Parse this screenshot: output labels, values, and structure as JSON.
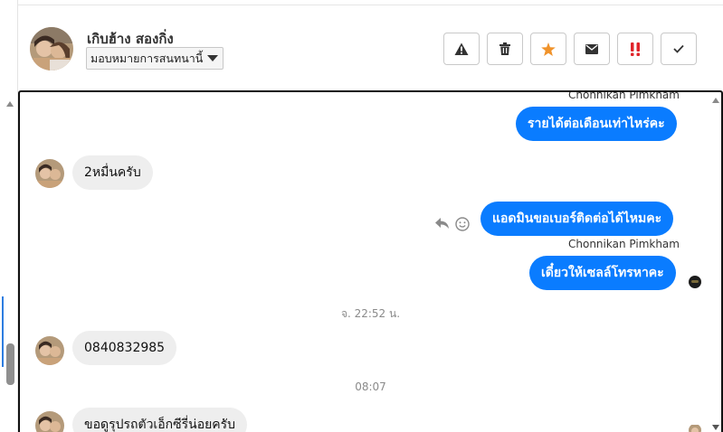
{
  "header": {
    "contact_name": "เกิบฮ้าง สองกิ่ง",
    "assign_select_value": "มอบหมายการสนทนานี้",
    "toolbar": {
      "spam_icon": "warning-icon",
      "delete_icon": "trash-icon",
      "star_icon": "star-icon",
      "mark_unread_icon": "envelope-icon",
      "priority_icon": "double-exclamation-icon",
      "done_icon": "checkmark-icon"
    }
  },
  "colors": {
    "outgoing_bubble": "#0a7cff",
    "incoming_bubble": "#eeeeee",
    "star": "#f0932b",
    "priority": "#e0242a"
  },
  "messages": [
    {
      "direction": "out",
      "sender": "Chonnikan Pimkham",
      "text": "รายได้ต่อเดือนเท่าไหร่คะ"
    },
    {
      "direction": "in",
      "text": "2หมื่นครับ"
    },
    {
      "direction": "out",
      "text": "แอดมินขอเบอร์ติดต่อได้ไหมคะ"
    },
    {
      "direction": "out",
      "sender": "Chonnikan Pimkham",
      "text": "เดี๋ยวให้เซลล์โทรหาคะ"
    },
    {
      "type": "timestamp",
      "text": "จ. 22:52 น."
    },
    {
      "direction": "in",
      "text": "0840832985"
    },
    {
      "type": "timestamp",
      "text": "08:07"
    },
    {
      "direction": "in",
      "text": "ขอดูรุปรถตัวเอ็กซีรี่น่อยครับ"
    }
  ]
}
